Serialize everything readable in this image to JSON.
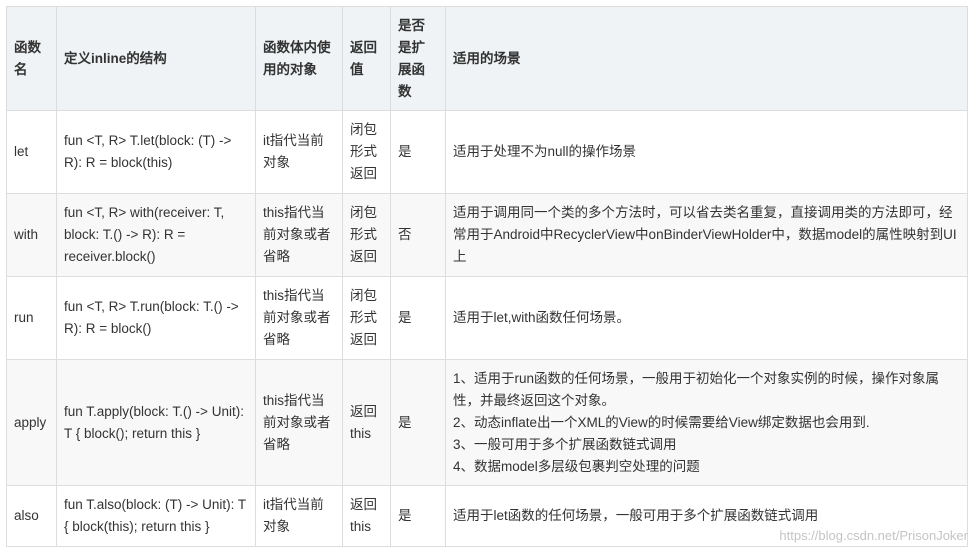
{
  "table": {
    "headers": [
      "函数名",
      "定义inline的结构",
      "函数体内使用的对象",
      "返回值",
      "是否是扩展函数",
      "适用的场景"
    ],
    "rows": [
      {
        "name": "let",
        "definition": "fun <T, R> T.let(block: (T) -> R): R = block(this)",
        "object": "it指代当前对象",
        "return": "闭包形式返回",
        "is_extension": "是",
        "scenario": [
          "适用于处理不为null的操作场景"
        ]
      },
      {
        "name": "with",
        "definition": "fun <T, R> with(receiver: T, block: T.() -> R): R = receiver.block()",
        "object": "this指代当前对象或者省略",
        "return": "闭包形式返回",
        "is_extension": "否",
        "scenario": [
          "适用于调用同一个类的多个方法时，可以省去类名重复，直接调用类的方法即可，经常用于Android中RecyclerView中onBinderViewHolder中，数据model的属性映射到UI上"
        ]
      },
      {
        "name": "run",
        "definition": "fun <T, R> T.run(block: T.() -> R): R = block()",
        "object": "this指代当前对象或者省略",
        "return": "闭包形式返回",
        "is_extension": "是",
        "scenario": [
          "适用于let,with函数任何场景。"
        ]
      },
      {
        "name": "apply",
        "definition": "fun T.apply(block: T.() -> Unit): T { block(); return this }",
        "object": "this指代当前对象或者省略",
        "return": "返回this",
        "is_extension": "是",
        "scenario": [
          "1、适用于run函数的任何场景，一般用于初始化一个对象实例的时候，操作对象属性，并最终返回这个对象。",
          "2、动态inflate出一个XML的View的时候需要给View绑定数据也会用到.",
          "3、一般可用于多个扩展函数链式调用",
          "4、数据model多层级包裹判空处理的问题"
        ]
      },
      {
        "name": "also",
        "definition": "fun T.also(block: (T) -> Unit): T { block(this); return this }",
        "object": "it指代当前对象",
        "return": "返回this",
        "is_extension": "是",
        "scenario": [
          "适用于let函数的任何场景，一般可用于多个扩展函数链式调用"
        ]
      }
    ]
  },
  "watermark": "https://blog.csdn.net/PrisonJoker"
}
